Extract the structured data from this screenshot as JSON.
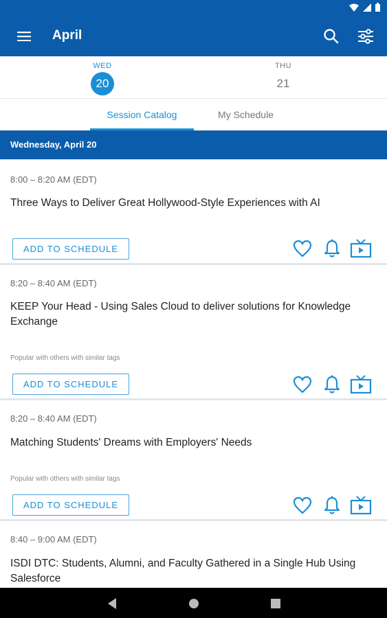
{
  "app": {
    "title": "April",
    "primary_color": "#0b5cab",
    "accent_color": "#1a8fd6"
  },
  "days": [
    {
      "weekday": "WED",
      "date": "20",
      "selected": true
    },
    {
      "weekday": "THU",
      "date": "21",
      "selected": false
    }
  ],
  "tabs": [
    {
      "label": "Session Catalog",
      "active": true
    },
    {
      "label": "My Schedule",
      "active": false
    }
  ],
  "date_header": "Wednesday, April 20",
  "sessions": [
    {
      "time": "8:00 – 8:20 AM (EDT)",
      "title": "Three Ways to Deliver Great Hollywood-Style Experiences with AI",
      "popular": "",
      "button": "ADD TO SCHEDULE"
    },
    {
      "time": "8:20 – 8:40 AM (EDT)",
      "title": "KEEP Your Head - Using Sales Cloud to deliver solutions for Knowledge Exchange",
      "popular": "Popular with others with similar tags",
      "button": "ADD TO SCHEDULE"
    },
    {
      "time": "8:20 – 8:40 AM (EDT)",
      "title": "Matching Students' Dreams with Employers' Needs",
      "popular": "Popular with others with similar tags",
      "button": "ADD TO SCHEDULE"
    },
    {
      "time": "8:40 – 9:00 AM (EDT)",
      "title": "ISDI DTC: Students, Alumni, and Faculty Gathered in a Single Hub Using Salesforce",
      "popular": "",
      "button": ""
    }
  ],
  "icons": {
    "menu": "hamburger-menu-icon",
    "search": "search-icon",
    "filter": "filter-sliders-icon",
    "favorite": "heart-icon",
    "reminder": "bell-icon",
    "video": "tv-icon"
  }
}
